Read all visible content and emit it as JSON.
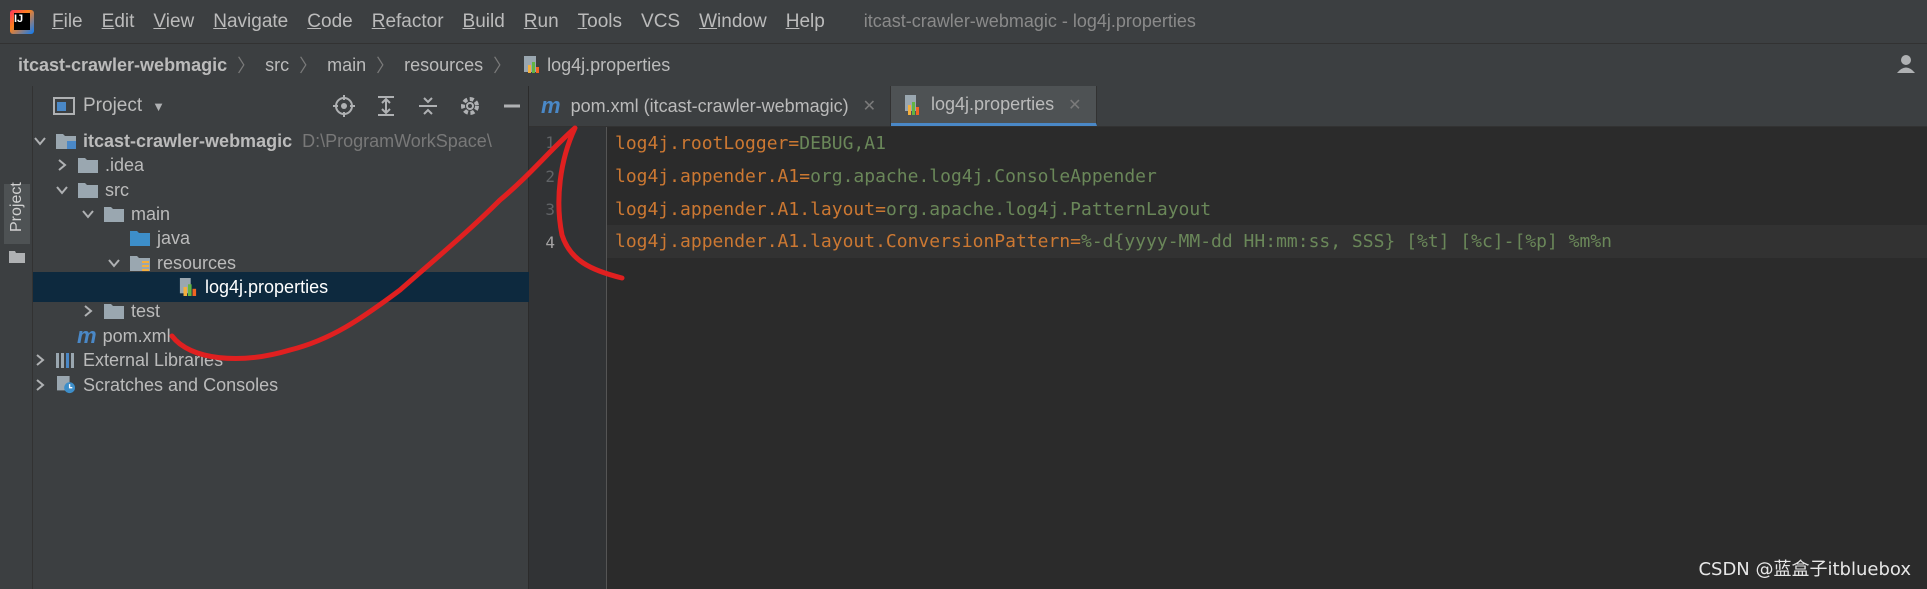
{
  "menubar": {
    "items": [
      {
        "label": "File",
        "mnemonic": "F",
        "rest": "ile"
      },
      {
        "label": "Edit",
        "mnemonic": "E",
        "rest": "dit"
      },
      {
        "label": "View",
        "mnemonic": "V",
        "rest": "iew"
      },
      {
        "label": "Navigate",
        "mnemonic": "N",
        "rest": "avigate"
      },
      {
        "label": "Code",
        "mnemonic": "C",
        "rest": "ode"
      },
      {
        "label": "Refactor",
        "mnemonic": "R",
        "rest": "efactor"
      },
      {
        "label": "Build",
        "mnemonic": "B",
        "rest": "uild"
      },
      {
        "label": "Run",
        "mnemonic": "R",
        "rest": "un"
      },
      {
        "label": "Tools",
        "mnemonic": "T",
        "rest": "ools"
      },
      {
        "label": "VCS",
        "mnemonic": "",
        "rest": "VCS"
      },
      {
        "label": "Window",
        "mnemonic": "W",
        "rest": "indow"
      },
      {
        "label": "Help",
        "mnemonic": "H",
        "rest": "elp"
      }
    ],
    "window_title": "itcast-crawler-webmagic - log4j.properties"
  },
  "breadcrumb": {
    "project": "itcast-crawler-webmagic",
    "src": "src",
    "main": "main",
    "resources": "resources",
    "file": "log4j.properties"
  },
  "toolstrip": {
    "project_label": "Project"
  },
  "project_panel": {
    "title": "Project",
    "tree": [
      {
        "label": "itcast-crawler-webmagic",
        "hint": "D:\\ProgramWorkSpace\\"
      },
      {
        "label": ".idea"
      },
      {
        "label": "src"
      },
      {
        "label": "main"
      },
      {
        "label": "java"
      },
      {
        "label": "resources"
      },
      {
        "label": "log4j.properties"
      },
      {
        "label": "test"
      },
      {
        "label": "pom.xml"
      },
      {
        "label": "External Libraries"
      },
      {
        "label": "Scratches and Consoles"
      }
    ]
  },
  "tabs": [
    {
      "label": "pom.xml (itcast-crawler-webmagic)",
      "icon": "m"
    },
    {
      "label": "log4j.properties"
    }
  ],
  "editor": {
    "lines": [
      {
        "num": "1",
        "key": "log4j.rootLogger",
        "eq": "=",
        "value": "DEBUG,A1"
      },
      {
        "num": "2",
        "key": "log4j.appender.A1",
        "eq": "=",
        "value": "org.apache.log4j.ConsoleAppender"
      },
      {
        "num": "3",
        "key": "log4j.appender.A1.layout",
        "eq": "=",
        "value": "org.apache.log4j.PatternLayout"
      },
      {
        "num": "4",
        "key": "log4j.appender.A1.layout.ConversionPattern",
        "eq": "=",
        "value": "%-d{yyyy-MM-dd HH:mm:ss, SSS} [%t] [%c]-[%p] %m%n"
      }
    ]
  },
  "watermark": "CSDN @蓝盒子itbluebox",
  "colors": {
    "keyword": "#cc7832",
    "value": "#6a8759",
    "annotation": "#e02020"
  }
}
